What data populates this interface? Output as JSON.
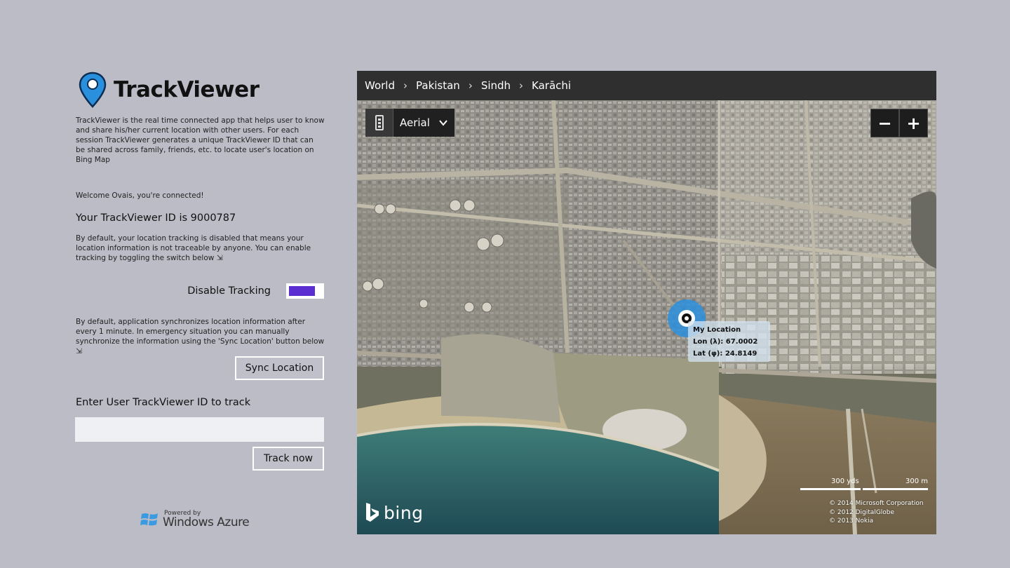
{
  "app": {
    "title": "TrackViewer",
    "intro": "TrackViewer is the real time connected app that helps user to know and share his/her current location with other users. For each session TrackViewer generates a unique TrackViewer ID that can be shared across family, friends, etc. to locate user's location on Bing Map"
  },
  "session": {
    "welcome": "Welcome Ovais, you're connected!",
    "id_line": "Your TrackViewer ID is 9000787",
    "tracking_desc": "By default, your location tracking is disabled that means your location information is not traceable by anyone. You can enable tracking by toggling the switch below ⇲",
    "tracking_label": "Disable Tracking",
    "tracking_on": true,
    "sync_desc": "By default, application synchronizes location information after every 1 minute. In emergency situation you can manually synchronize the information using the 'Sync Location' button below ⇲",
    "sync_button": "Sync Location"
  },
  "track": {
    "label": "Enter User TrackViewer ID to track",
    "input_value": "",
    "button": "Track now"
  },
  "footer": {
    "powered_by": "Powered by",
    "brand": "Windows Azure"
  },
  "map": {
    "breadcrumb": [
      "World",
      "Pakistan",
      "Sindh",
      "Karāchi"
    ],
    "map_style": "Aerial",
    "zoom_out": "−",
    "zoom_in": "+",
    "location_card": {
      "title": "My Location",
      "lon": "Lon (λ): 67.0002",
      "lat": "Lat (φ): 24.8149"
    },
    "scale": {
      "yards": "300 yds",
      "meters": "300 m"
    },
    "copyright": [
      "© 2014 Microsoft Corporation",
      "© 2012 DigitalGlobe",
      "© 2013 Nokia"
    ],
    "logo_text": "bing"
  },
  "colors": {
    "page_bg": "#bbbcc6",
    "toggle_fill": "#5b2ed1",
    "breadcrumb_bg": "#2f2f2f",
    "pin_blue": "#2a8fdc"
  }
}
